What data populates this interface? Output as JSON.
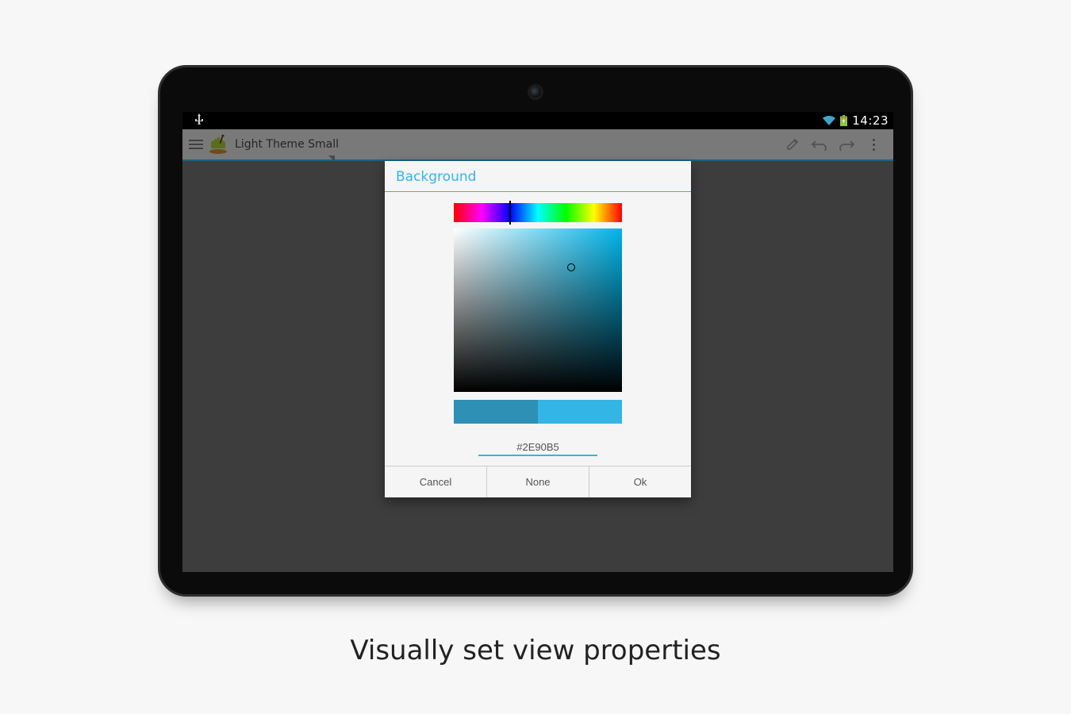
{
  "statusbar": {
    "time": "14:23"
  },
  "actionbar": {
    "title": "Light Theme Small"
  },
  "dialog": {
    "title": "Background",
    "hex_value": "#2E90B5",
    "swatch_current": "#2e90b5",
    "swatch_preview": "#33b5e5",
    "buttons": {
      "cancel": "Cancel",
      "none": "None",
      "ok": "Ok"
    }
  },
  "caption": "Visually set view properties"
}
